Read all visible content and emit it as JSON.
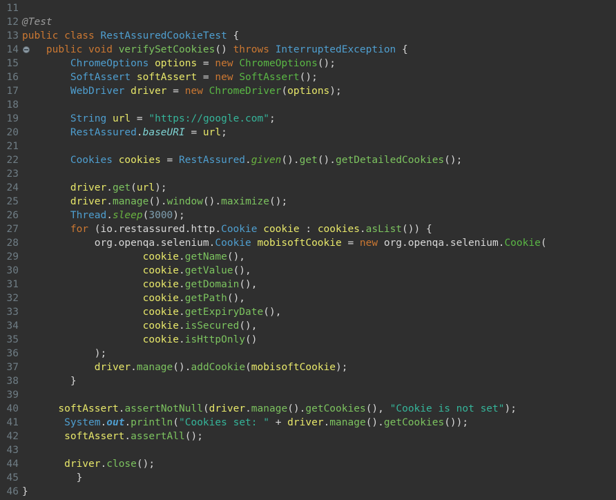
{
  "editor": {
    "name": "java-code-editor",
    "background": "#2f2f2f",
    "gutter_color": "#6f7d85",
    "first_line": 11,
    "last_line": 46,
    "marker_line": 14,
    "marker_icon": "method-overrides-marker-icon",
    "palette": {
      "keyword": "#cc7832",
      "type": "#4f9fd0",
      "constructor": "#5ab745",
      "method": "#7cc35f",
      "static_method": "#69b340",
      "static_field": "#7fd4d4",
      "variable": "#e8e86a",
      "string": "#35b59a",
      "number": "#7f9fb0",
      "annotation": "#9a9a9a",
      "plain": "#d8d8d8"
    }
  },
  "line_numbers": [
    "11",
    "12",
    "13",
    "14",
    "15",
    "16",
    "17",
    "18",
    "19",
    "20",
    "21",
    "22",
    "23",
    "24",
    "25",
    "26",
    "27",
    "28",
    "29",
    "30",
    "31",
    "32",
    "33",
    "34",
    "35",
    "36",
    "37",
    "38",
    "39",
    "40",
    "41",
    "42",
    "43",
    "44",
    "45",
    "46"
  ],
  "code_lines": [
    {
      "n": 11,
      "text": ""
    },
    {
      "n": 12,
      "text": "@Test"
    },
    {
      "n": 13,
      "text": "public class RestAssuredCookieTest {"
    },
    {
      "n": 14,
      "text": "    public void verifySetCookies() throws InterruptedException {"
    },
    {
      "n": 15,
      "text": "        ChromeOptions options = new ChromeOptions();"
    },
    {
      "n": 16,
      "text": "        SoftAssert softAssert = new SoftAssert();"
    },
    {
      "n": 17,
      "text": "        WebDriver driver = new ChromeDriver(options);"
    },
    {
      "n": 18,
      "text": ""
    },
    {
      "n": 19,
      "text": "        String url = \"https://google.com\";"
    },
    {
      "n": 20,
      "text": "        RestAssured.baseURI = url;"
    },
    {
      "n": 21,
      "text": ""
    },
    {
      "n": 22,
      "text": "        Cookies cookies = RestAssured.given().get().getDetailedCookies();"
    },
    {
      "n": 23,
      "text": ""
    },
    {
      "n": 24,
      "text": "        driver.get(url);"
    },
    {
      "n": 25,
      "text": "        driver.manage().window().maximize();"
    },
    {
      "n": 26,
      "text": "        Thread.sleep(3000);"
    },
    {
      "n": 27,
      "text": "        for (io.restassured.http.Cookie cookie : cookies.asList()) {"
    },
    {
      "n": 28,
      "text": "            org.openqa.selenium.Cookie mobisoftCookie = new org.openqa.selenium.Cookie("
    },
    {
      "n": 29,
      "text": "                    cookie.getName(),"
    },
    {
      "n": 30,
      "text": "                    cookie.getValue(),"
    },
    {
      "n": 31,
      "text": "                    cookie.getDomain(),"
    },
    {
      "n": 32,
      "text": "                    cookie.getPath(),"
    },
    {
      "n": 33,
      "text": "                    cookie.getExpiryDate(),"
    },
    {
      "n": 34,
      "text": "                    cookie.isSecured(),"
    },
    {
      "n": 35,
      "text": "                    cookie.isHttpOnly()"
    },
    {
      "n": 36,
      "text": "            );"
    },
    {
      "n": 37,
      "text": "            driver.manage().addCookie(mobisoftCookie);"
    },
    {
      "n": 38,
      "text": "        }"
    },
    {
      "n": 39,
      "text": ""
    },
    {
      "n": 40,
      "text": "      softAssert.assertNotNull(driver.manage().getCookies(), \"Cookie is not set\");"
    },
    {
      "n": 41,
      "text": "       System.out.println(\"Cookies set: \" + driver.manage().getCookies());"
    },
    {
      "n": 42,
      "text": "       softAssert.assertAll();"
    },
    {
      "n": 43,
      "text": ""
    },
    {
      "n": 44,
      "text": "       driver.close();"
    },
    {
      "n": 45,
      "text": "         }"
    },
    {
      "n": 46,
      "text": "}"
    }
  ],
  "tokens": [
    [],
    [
      {
        "t": "@Test",
        "c": "ann",
        "pad": 2
      }
    ],
    [
      {
        "t": "public class ",
        "c": "kw",
        "pad": 0
      },
      {
        "t": "RestAssuredCookieTest",
        "c": "type"
      },
      {
        "t": " {",
        "c": "punc"
      }
    ],
    [
      {
        "t": "    public void ",
        "c": "kw"
      },
      {
        "t": "verifySetCookies",
        "c": "meth"
      },
      {
        "t": "() ",
        "c": "punc"
      },
      {
        "t": "throws ",
        "c": "kw"
      },
      {
        "t": "InterruptedException",
        "c": "type"
      },
      {
        "t": " {",
        "c": "punc"
      }
    ],
    [
      {
        "t": "        ",
        "c": "plain"
      },
      {
        "t": "ChromeOptions",
        "c": "type"
      },
      {
        "t": " ",
        "c": "plain"
      },
      {
        "t": "options",
        "c": "var"
      },
      {
        "t": " = ",
        "c": "punc"
      },
      {
        "t": "new ",
        "c": "kw"
      },
      {
        "t": "ChromeOptions",
        "c": "ctor"
      },
      {
        "t": "();",
        "c": "punc"
      }
    ],
    [
      {
        "t": "        ",
        "c": "plain"
      },
      {
        "t": "SoftAssert",
        "c": "type"
      },
      {
        "t": " ",
        "c": "plain"
      },
      {
        "t": "softAssert",
        "c": "var"
      },
      {
        "t": " = ",
        "c": "punc"
      },
      {
        "t": "new ",
        "c": "kw"
      },
      {
        "t": "SoftAssert",
        "c": "ctor"
      },
      {
        "t": "();",
        "c": "punc"
      }
    ],
    [
      {
        "t": "        ",
        "c": "plain"
      },
      {
        "t": "WebDriver",
        "c": "type"
      },
      {
        "t": " ",
        "c": "plain"
      },
      {
        "t": "driver",
        "c": "var"
      },
      {
        "t": " = ",
        "c": "punc"
      },
      {
        "t": "new ",
        "c": "kw"
      },
      {
        "t": "ChromeDriver",
        "c": "ctor"
      },
      {
        "t": "(",
        "c": "punc"
      },
      {
        "t": "options",
        "c": "var"
      },
      {
        "t": ");",
        "c": "punc"
      }
    ],
    [],
    [
      {
        "t": "        ",
        "c": "plain"
      },
      {
        "t": "String",
        "c": "type"
      },
      {
        "t": " ",
        "c": "plain"
      },
      {
        "t": "url",
        "c": "var"
      },
      {
        "t": " = ",
        "c": "punc"
      },
      {
        "t": "\"https://google.com\"",
        "c": "str"
      },
      {
        "t": ";",
        "c": "punc"
      }
    ],
    [
      {
        "t": "        ",
        "c": "plain"
      },
      {
        "t": "RestAssured",
        "c": "type"
      },
      {
        "t": ".",
        "c": "punc"
      },
      {
        "t": "baseURI",
        "c": "sfield"
      },
      {
        "t": " = ",
        "c": "punc"
      },
      {
        "t": "url",
        "c": "var"
      },
      {
        "t": ";",
        "c": "punc"
      }
    ],
    [],
    [
      {
        "t": "        ",
        "c": "plain"
      },
      {
        "t": "Cookies",
        "c": "type"
      },
      {
        "t": " ",
        "c": "plain"
      },
      {
        "t": "cookies",
        "c": "var"
      },
      {
        "t": " = ",
        "c": "punc"
      },
      {
        "t": "RestAssured",
        "c": "type"
      },
      {
        "t": ".",
        "c": "punc"
      },
      {
        "t": "given",
        "c": "smeth"
      },
      {
        "t": "().",
        "c": "punc"
      },
      {
        "t": "get",
        "c": "meth"
      },
      {
        "t": "().",
        "c": "punc"
      },
      {
        "t": "getDetailedCookies",
        "c": "meth"
      },
      {
        "t": "();",
        "c": "punc"
      }
    ],
    [],
    [
      {
        "t": "        ",
        "c": "plain"
      },
      {
        "t": "driver",
        "c": "var"
      },
      {
        "t": ".",
        "c": "punc"
      },
      {
        "t": "get",
        "c": "meth"
      },
      {
        "t": "(",
        "c": "punc"
      },
      {
        "t": "url",
        "c": "var"
      },
      {
        "t": ");",
        "c": "punc"
      }
    ],
    [
      {
        "t": "        ",
        "c": "plain"
      },
      {
        "t": "driver",
        "c": "var"
      },
      {
        "t": ".",
        "c": "punc"
      },
      {
        "t": "manage",
        "c": "meth"
      },
      {
        "t": "().",
        "c": "punc"
      },
      {
        "t": "window",
        "c": "meth"
      },
      {
        "t": "().",
        "c": "punc"
      },
      {
        "t": "maximize",
        "c": "meth"
      },
      {
        "t": "();",
        "c": "punc"
      }
    ],
    [
      {
        "t": "        ",
        "c": "plain"
      },
      {
        "t": "Thread",
        "c": "type"
      },
      {
        "t": ".",
        "c": "punc"
      },
      {
        "t": "sleep",
        "c": "smeth"
      },
      {
        "t": "(",
        "c": "punc"
      },
      {
        "t": "3000",
        "c": "num"
      },
      {
        "t": ");",
        "c": "punc"
      }
    ],
    [
      {
        "t": "        ",
        "c": "plain"
      },
      {
        "t": "for ",
        "c": "kw"
      },
      {
        "t": "(io.restassured.http.",
        "c": "pkg"
      },
      {
        "t": "Cookie",
        "c": "type"
      },
      {
        "t": " ",
        "c": "plain"
      },
      {
        "t": "cookie",
        "c": "var"
      },
      {
        "t": " : ",
        "c": "punc"
      },
      {
        "t": "cookies",
        "c": "var"
      },
      {
        "t": ".",
        "c": "punc"
      },
      {
        "t": "asList",
        "c": "meth"
      },
      {
        "t": "()) {",
        "c": "punc"
      }
    ],
    [
      {
        "t": "            ",
        "c": "plain"
      },
      {
        "t": "org.openqa.selenium.",
        "c": "pkg"
      },
      {
        "t": "Cookie",
        "c": "type"
      },
      {
        "t": " ",
        "c": "plain"
      },
      {
        "t": "mobisoftCookie",
        "c": "var"
      },
      {
        "t": " = ",
        "c": "punc"
      },
      {
        "t": "new ",
        "c": "kw"
      },
      {
        "t": "org.openqa.selenium.",
        "c": "pkg"
      },
      {
        "t": "Cookie",
        "c": "ctor"
      },
      {
        "t": "(",
        "c": "punc"
      }
    ],
    [
      {
        "t": "                    ",
        "c": "plain"
      },
      {
        "t": "cookie",
        "c": "var"
      },
      {
        "t": ".",
        "c": "punc"
      },
      {
        "t": "getName",
        "c": "meth"
      },
      {
        "t": "(),",
        "c": "punc"
      }
    ],
    [
      {
        "t": "                    ",
        "c": "plain"
      },
      {
        "t": "cookie",
        "c": "var"
      },
      {
        "t": ".",
        "c": "punc"
      },
      {
        "t": "getValue",
        "c": "meth"
      },
      {
        "t": "(),",
        "c": "punc"
      }
    ],
    [
      {
        "t": "                    ",
        "c": "plain"
      },
      {
        "t": "cookie",
        "c": "var"
      },
      {
        "t": ".",
        "c": "punc"
      },
      {
        "t": "getDomain",
        "c": "meth"
      },
      {
        "t": "(),",
        "c": "punc"
      }
    ],
    [
      {
        "t": "                    ",
        "c": "plain"
      },
      {
        "t": "cookie",
        "c": "var"
      },
      {
        "t": ".",
        "c": "punc"
      },
      {
        "t": "getPath",
        "c": "meth"
      },
      {
        "t": "(),",
        "c": "punc"
      }
    ],
    [
      {
        "t": "                    ",
        "c": "plain"
      },
      {
        "t": "cookie",
        "c": "var"
      },
      {
        "t": ".",
        "c": "punc"
      },
      {
        "t": "getExpiryDate",
        "c": "meth"
      },
      {
        "t": "(),",
        "c": "punc"
      }
    ],
    [
      {
        "t": "                    ",
        "c": "plain"
      },
      {
        "t": "cookie",
        "c": "var"
      },
      {
        "t": ".",
        "c": "punc"
      },
      {
        "t": "isSecured",
        "c": "meth"
      },
      {
        "t": "(),",
        "c": "punc"
      }
    ],
    [
      {
        "t": "                    ",
        "c": "plain"
      },
      {
        "t": "cookie",
        "c": "var"
      },
      {
        "t": ".",
        "c": "punc"
      },
      {
        "t": "isHttpOnly",
        "c": "meth"
      },
      {
        "t": "()",
        "c": "punc"
      }
    ],
    [
      {
        "t": "            );",
        "c": "punc"
      }
    ],
    [
      {
        "t": "            ",
        "c": "plain"
      },
      {
        "t": "driver",
        "c": "var"
      },
      {
        "t": ".",
        "c": "punc"
      },
      {
        "t": "manage",
        "c": "meth"
      },
      {
        "t": "().",
        "c": "punc"
      },
      {
        "t": "addCookie",
        "c": "meth"
      },
      {
        "t": "(",
        "c": "punc"
      },
      {
        "t": "mobisoftCookie",
        "c": "var"
      },
      {
        "t": ");",
        "c": "punc"
      }
    ],
    [
      {
        "t": "        }",
        "c": "punc"
      }
    ],
    [],
    [
      {
        "t": "      ",
        "c": "plain"
      },
      {
        "t": "softAssert",
        "c": "var"
      },
      {
        "t": ".",
        "c": "punc"
      },
      {
        "t": "assertNotNull",
        "c": "meth"
      },
      {
        "t": "(",
        "c": "punc"
      },
      {
        "t": "driver",
        "c": "var"
      },
      {
        "t": ".",
        "c": "punc"
      },
      {
        "t": "manage",
        "c": "meth"
      },
      {
        "t": "().",
        "c": "punc"
      },
      {
        "t": "getCookies",
        "c": "meth"
      },
      {
        "t": "(), ",
        "c": "punc"
      },
      {
        "t": "\"Cookie is not set\"",
        "c": "str"
      },
      {
        "t": ");",
        "c": "punc"
      }
    ],
    [
      {
        "t": "       ",
        "c": "plain"
      },
      {
        "t": "System",
        "c": "type"
      },
      {
        "t": ".",
        "c": "punc"
      },
      {
        "t": "out",
        "c": "sfieldb"
      },
      {
        "t": ".",
        "c": "punc"
      },
      {
        "t": "println",
        "c": "meth"
      },
      {
        "t": "(",
        "c": "punc"
      },
      {
        "t": "\"Cookies set: \"",
        "c": "str"
      },
      {
        "t": " + ",
        "c": "punc"
      },
      {
        "t": "driver",
        "c": "var"
      },
      {
        "t": ".",
        "c": "punc"
      },
      {
        "t": "manage",
        "c": "meth"
      },
      {
        "t": "().",
        "c": "punc"
      },
      {
        "t": "getCookies",
        "c": "meth"
      },
      {
        "t": "());",
        "c": "punc"
      }
    ],
    [
      {
        "t": "       ",
        "c": "plain"
      },
      {
        "t": "softAssert",
        "c": "var"
      },
      {
        "t": ".",
        "c": "punc"
      },
      {
        "t": "assertAll",
        "c": "meth"
      },
      {
        "t": "();",
        "c": "punc"
      }
    ],
    [],
    [
      {
        "t": "       ",
        "c": "plain"
      },
      {
        "t": "driver",
        "c": "var"
      },
      {
        "t": ".",
        "c": "punc"
      },
      {
        "t": "close",
        "c": "meth"
      },
      {
        "t": "();",
        "c": "punc"
      }
    ],
    [
      {
        "t": "         }",
        "c": "punc"
      }
    ],
    [
      {
        "t": "}",
        "c": "punc"
      }
    ]
  ]
}
